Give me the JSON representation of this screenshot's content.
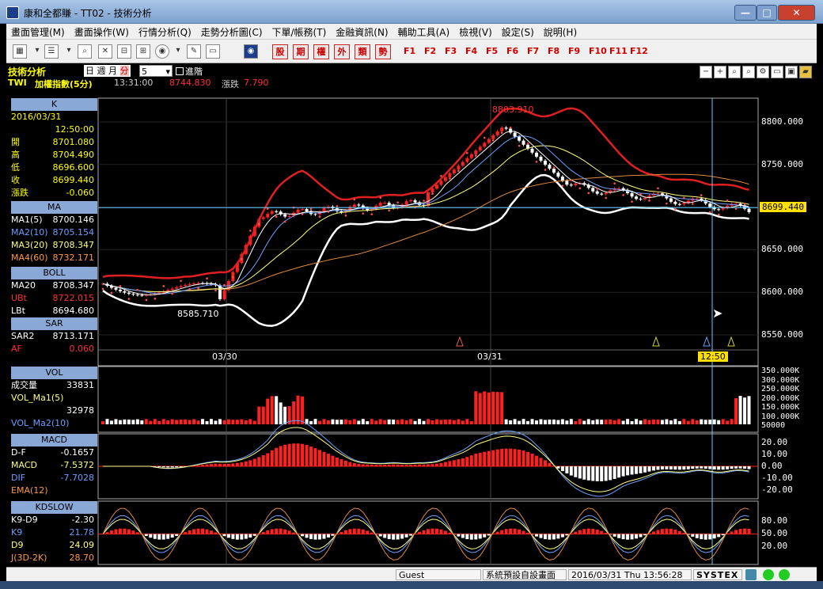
{
  "window": {
    "title": "康和全都賺 - TT02 - 技術分析",
    "min": "—",
    "max": "□",
    "close": "✕"
  },
  "menu": [
    "畫面管理(M)",
    "畫面操作(W)",
    "行情分析(Q)",
    "走勢分析圖(C)",
    "下單/帳務(T)",
    "金融資訊(N)",
    "輔助工具(A)",
    "檢視(V)",
    "設定(S)",
    "說明(H)"
  ],
  "toolbar": {
    "red_buttons": [
      "股",
      "期",
      "權",
      "外",
      "類",
      "勢"
    ],
    "fkeys": [
      "F1",
      "F2",
      "F3",
      "F4",
      "F5",
      "F6",
      "F7",
      "F8",
      "F9",
      "F10",
      "F11",
      "F12"
    ]
  },
  "info": {
    "panel_title": "技術分析",
    "periods": [
      "日",
      "週",
      "月",
      "分"
    ],
    "interval": "5",
    "mode": "進階",
    "symbol": "TWI",
    "name": "加權指數(5分)",
    "time": "13:31:00",
    "price": "8744.830",
    "change_label": "漲跌",
    "change": "7.790"
  },
  "k": {
    "header": "K",
    "date": "2016/03/31",
    "time": "12:50:00",
    "rows": [
      [
        "開",
        "8701.080"
      ],
      [
        "高",
        "8704.490"
      ],
      [
        "低",
        "8696.600"
      ],
      [
        "收",
        "8699.440"
      ],
      [
        "漲跌",
        "-0.060"
      ]
    ]
  },
  "ma": {
    "header": "MA",
    "rows": [
      [
        "MA1(5)",
        "8700.146"
      ],
      [
        "MA2(10)",
        "8705.154"
      ],
      [
        "MA3(20)",
        "8708.347"
      ],
      [
        "MA4(60)",
        "8732.171"
      ]
    ]
  },
  "boll": {
    "header": "BOLL",
    "rows": [
      [
        "MA20",
        "8708.347"
      ],
      [
        "UBt",
        "8722.015"
      ],
      [
        "LBt",
        "8694.680"
      ]
    ]
  },
  "sar": {
    "header": "SAR",
    "rows": [
      [
        "SAR2",
        "8713.171"
      ],
      [
        "AF",
        "0.060"
      ]
    ]
  },
  "vol": {
    "header": "VOL",
    "rows": [
      [
        "成交量",
        "33831"
      ],
      [
        "VOL_Ma1(5)",
        ""
      ],
      [
        "",
        "32978"
      ],
      [
        "VOL_Ma2(10)",
        ""
      ]
    ]
  },
  "macd": {
    "header": "MACD",
    "rows": [
      [
        "D-F",
        "-0.1657"
      ],
      [
        "MACD",
        "-7.5372"
      ],
      [
        "DIF",
        "-7.7028"
      ],
      [
        "EMA(12)",
        ""
      ]
    ]
  },
  "kd": {
    "header": "KDSLOW",
    "rows": [
      [
        "K9-D9",
        "-2.30"
      ],
      [
        "K9",
        "21.78"
      ],
      [
        "D9",
        "24.09"
      ],
      [
        "J(3D-2K)",
        "28.70"
      ]
    ]
  },
  "price_axis": [
    "8800.000",
    "8750.000",
    "8700.000",
    "8650.000",
    "8600.000",
    "8550.000"
  ],
  "current_price": "8699.440",
  "high_label": "8803.910",
  "low_label": "8585.710",
  "date_labels": [
    "03/30",
    "03/31"
  ],
  "cursor_time": "12:50",
  "vol_axis": [
    "350.000K",
    "300.000K",
    "250.000K",
    "200.000K",
    "150.000K",
    "100.000K",
    "50000"
  ],
  "macd_axis": [
    "20.00",
    "10.00",
    "0.00",
    "-10.00",
    "-20.00"
  ],
  "kd_axis": [
    "80.00",
    "50.00",
    "20.00"
  ],
  "status": {
    "user": "Guest",
    "layout": "系統預設自設畫面",
    "datetime": "2016/03/31 Thu 13:56:28",
    "brand": "SYSTEX"
  },
  "colors": {
    "bg": "#000000",
    "up": "#ff2020",
    "down": "#ffffff",
    "ubt": "#e02020",
    "lbt": "#ffffff",
    "ma60": "#e08a40",
    "label_hdr": "#8aa8d6",
    "price_tag": "#ffe000"
  }
}
